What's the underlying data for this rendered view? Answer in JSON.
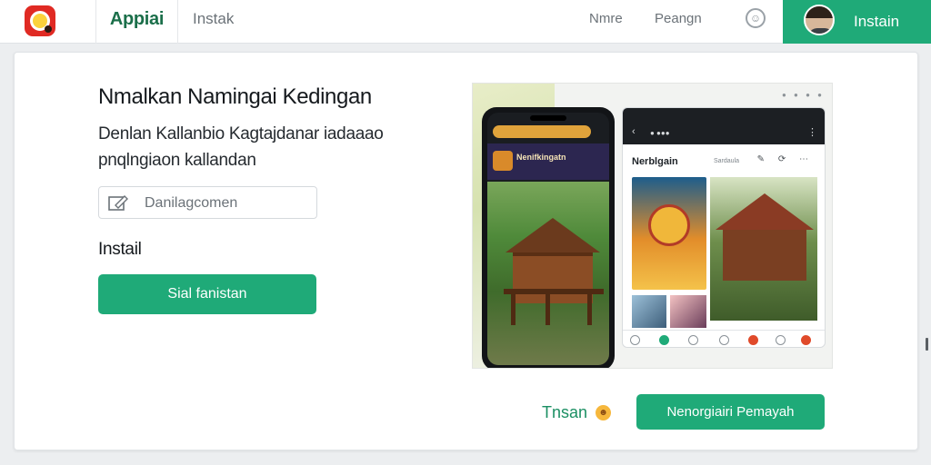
{
  "topbar": {
    "brand": "Appiai",
    "tab": "Instak",
    "links": [
      "Nmre",
      "Peangn"
    ],
    "install_label": "Instain"
  },
  "hero": {
    "title": "Nmalkan Namingai Kedingan",
    "subtitle": "Denlan Kallanbio Kagtajdanar iadaaao pnqlngiaon kallandan",
    "search_placeholder": "Danilagcomen",
    "section_label": "Instail",
    "primary_button": "Sial fanistan"
  },
  "preview": {
    "phone_banner": "Nenifkingatn",
    "tablet_title": "Nerblgain",
    "tablet_subtitle": "Sardaula"
  },
  "footer": {
    "link_label": "Tnsan",
    "secondary_button": "Nenorgiairi Pemayah"
  },
  "colors": {
    "accent": "#1faa78",
    "brand_text": "#1b6f4a"
  }
}
